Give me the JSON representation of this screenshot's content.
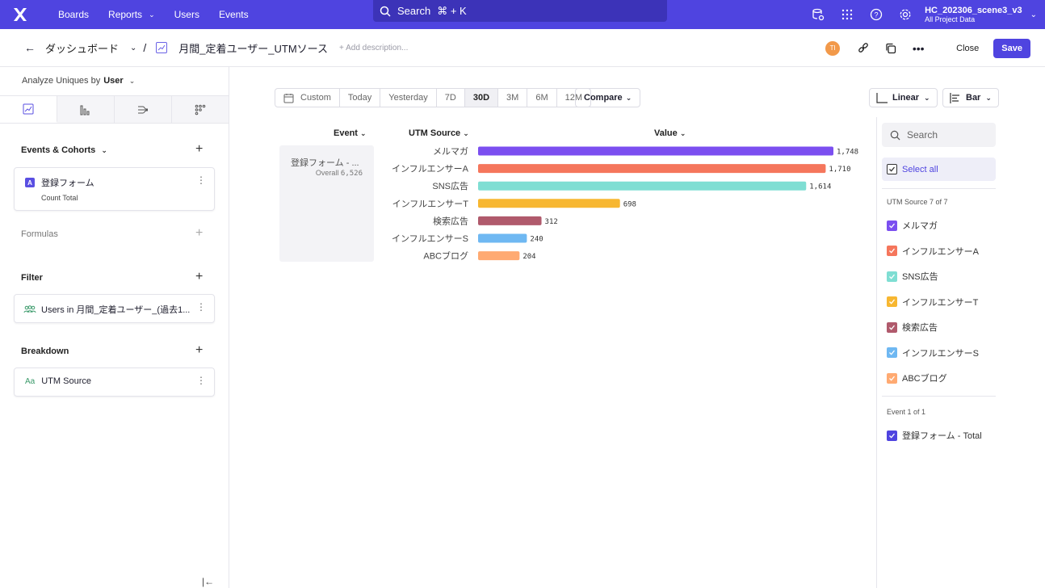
{
  "topbar": {
    "nav": [
      {
        "label": "Boards"
      },
      {
        "label": "Reports",
        "has_caret": true
      },
      {
        "label": "Users"
      },
      {
        "label": "Events"
      }
    ],
    "search_label": "Search",
    "search_shortcut": "⌘ + K",
    "project_name": "HC_202306_scene3_v3",
    "project_sub": "All Project Data"
  },
  "titlebar": {
    "breadcrumb": "ダッシュボード",
    "title": "月間_定着ユーザー_UTMソース",
    "add_description": "+ Add description...",
    "avatar_initials": "TI",
    "close_label": "Close",
    "save_label": "Save"
  },
  "left": {
    "analyze_label": "Analyze Uniques by",
    "analyze_value": "User",
    "events_title": "Events & Cohorts",
    "event_badge": "A",
    "event_name": "登録フォーム",
    "event_measure": "Count Total",
    "formulas_title": "Formulas",
    "filter_title": "Filter",
    "filter_value": "Users in 月間_定着ユーザー_(過去1...",
    "breakdown_title": "Breakdown",
    "breakdown_type": "Aa",
    "breakdown_value": "UTM Source"
  },
  "controls": {
    "date_ranges": [
      {
        "label": "Custom"
      },
      {
        "label": "Today"
      },
      {
        "label": "Yesterday"
      },
      {
        "label": "7D"
      },
      {
        "label": "30D",
        "active": true
      },
      {
        "label": "3M"
      },
      {
        "label": "6M"
      },
      {
        "label": "12M"
      }
    ],
    "compare_label": "Compare",
    "scale_label": "Linear",
    "chart_type_label": "Bar"
  },
  "table": {
    "col_event": "Event",
    "col_source": "UTM Source",
    "col_value": "Value",
    "event_cell": "登録フォーム - ...",
    "overall_label": "Overall",
    "overall_value": "6,526"
  },
  "chart_data": {
    "type": "bar",
    "orientation": "horizontal",
    "categories": [
      "メルマガ",
      "インフルエンサーA",
      "SNS広告",
      "インフルエンサーT",
      "検索広告",
      "インフルエンサーS",
      "ABCブログ"
    ],
    "values": [
      1748,
      1710,
      1614,
      698,
      312,
      240,
      204
    ],
    "value_labels": [
      "1,748",
      "1,710",
      "1,614",
      "698",
      "312",
      "240",
      "204"
    ],
    "colors": [
      "#7b4ff0",
      "#f5765c",
      "#7fded3",
      "#f7b731",
      "#b05a6c",
      "#6fb8f2",
      "#ffaa72"
    ],
    "xlim": [
      0,
      1748
    ]
  },
  "legend_panel": {
    "search_placeholder": "Search",
    "select_all": "Select all",
    "source_header": "UTM Source 7 of 7",
    "event_header": "Event 1 of 1",
    "event_item": "登録フォーム - Total",
    "event_color": "#4f44e0"
  }
}
